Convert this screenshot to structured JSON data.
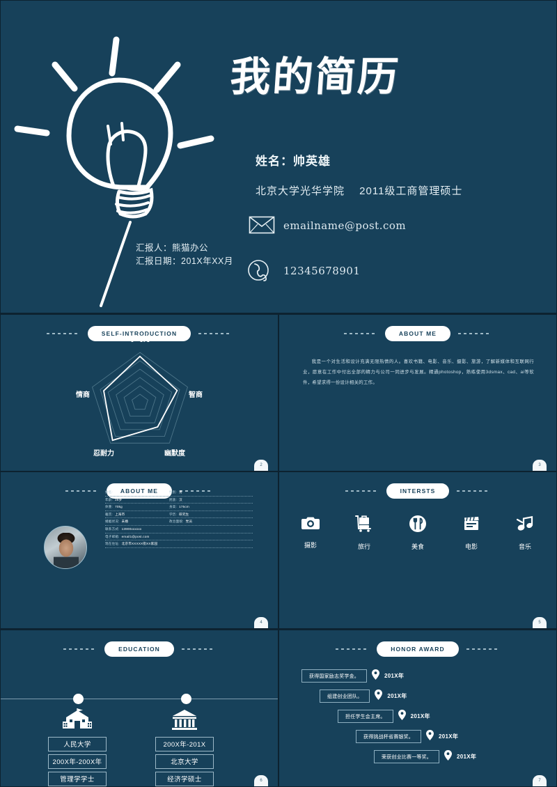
{
  "theme": {
    "bg": "#17415a",
    "accent": "#ffffff",
    "gutter": "#0d2230"
  },
  "cover": {
    "title": "我的简历",
    "name_line": "姓名：帅英雄",
    "school_line": "北京大学光华学院　  2011级工商管理硕士",
    "email": "emailname@post.com",
    "phone": "12345678901",
    "reporter": "汇报人：熊猫办公",
    "report_date": "汇报日期：201X年XX月",
    "mail_icon": "envelope-icon",
    "phone_icon": "telephone-icon",
    "bulb_icon": "lightbulb-icon"
  },
  "slides": [
    {
      "id": "self-introduction",
      "header": "SELF-INTRODUCTION",
      "page": "2"
    },
    {
      "id": "about-me-text",
      "header": "ABOUT ME",
      "page": "3",
      "body": "我是一个对生活和设计充满无限热情的人。喜欢书籍、电影、音乐、摄影、旅游，了解新媒体和互联网行业，愿意在工作中付出全部的精力与公司一同进步与发展。精通photoshop，熟练使用3dsmax、cad、ai等软件，希望求得一份设计相关的工作。"
    },
    {
      "id": "about-me-profile",
      "header": "ABOUT ME",
      "page": "4"
    },
    {
      "id": "interests",
      "header": "INTERSTS",
      "page": "5"
    },
    {
      "id": "education",
      "header": "EDUCATION",
      "page": "6"
    },
    {
      "id": "honor-award",
      "header": "HONOR AWARD",
      "page": "7"
    }
  ],
  "chart_data": {
    "type": "radar",
    "title": "",
    "categories": [
      "学习力",
      "智商",
      "幽默度",
      "忍耐力",
      "情商"
    ],
    "values": [
      92,
      78,
      60,
      93,
      76
    ],
    "rmax": 100,
    "rings": 6,
    "grid": true,
    "legend": "none",
    "series": [
      {
        "name": "能力",
        "values": [
          92,
          78,
          60,
          93,
          76
        ]
      }
    ]
  },
  "profile": {
    "avatar": "portrait-photo",
    "rows": [
      [
        {
          "key": "姓名:",
          "value": "XJ"
        },
        {
          "key": "性别:",
          "value": "男"
        }
      ],
      [
        {
          "key": "年龄:",
          "value": "28岁"
        },
        {
          "key": "民族:",
          "value": "汉"
        }
      ],
      [
        {
          "key": "体重:",
          "value": "70kg"
        },
        {
          "key": "身高:",
          "value": "175cm"
        }
      ],
      [
        {
          "key": "籍贯:",
          "value": "上海市"
        },
        {
          "key": "学历:",
          "value": "研究生"
        }
      ],
      [
        {
          "key": "婚姻状况:",
          "value": "未婚"
        },
        {
          "key": "政治面貌:",
          "value": "党员"
        }
      ]
    ],
    "wide_rows": [
      {
        "key": "联系方式:",
        "value": "13900xxxxxx"
      },
      {
        "key": "电子邮箱:",
        "value": "email1@post.com"
      },
      {
        "key": "现在住址:",
        "value": "北京市XXXXX街XX家园"
      }
    ]
  },
  "interests": [
    {
      "label": "摄影",
      "icon": "camera-icon"
    },
    {
      "label": "旅行",
      "icon": "luggage-cart-icon"
    },
    {
      "label": "美食",
      "icon": "fork-knife-plate-icon"
    },
    {
      "label": "电影",
      "icon": "clapperboard-icon"
    },
    {
      "label": "音乐",
      "icon": "music-note-icon"
    }
  ],
  "education": [
    {
      "icon": "school-building-icon",
      "tags": [
        "人民大学",
        "200X年-200X年",
        "管理学学士"
      ]
    },
    {
      "icon": "university-column-icon",
      "tags": [
        "200X年-201X",
        "北京大学",
        "经济学硕士"
      ]
    }
  ],
  "honors": [
    {
      "text": "获得国家励志奖学金。",
      "year": "201X年",
      "pin": "map-pin-icon"
    },
    {
      "text": "组建创业团队。",
      "year": "201X年",
      "pin": "map-pin-icon"
    },
    {
      "text": "担任学生会主席。",
      "year": "201X年",
      "pin": "map-pin-icon"
    },
    {
      "text": "获得挑战杯省赛银奖。",
      "year": "201X年",
      "pin": "map-pin-icon"
    },
    {
      "text": "荣获创业比赛一等奖。",
      "year": "201X年",
      "pin": "map-pin-icon"
    }
  ]
}
